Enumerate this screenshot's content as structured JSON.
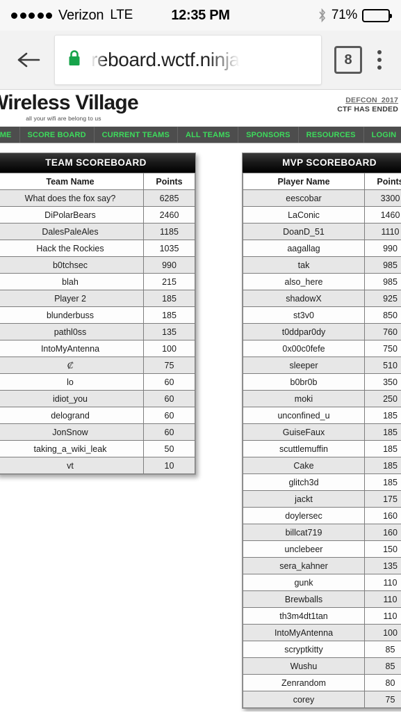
{
  "status_bar": {
    "signal_dots": 5,
    "carrier": "Verizon",
    "network": "LTE",
    "time": "12:35 PM",
    "bluetooth_icon": "bluetooth-icon",
    "battery_percent": "71%",
    "battery_level": 75
  },
  "browser": {
    "back_icon": "back-arrow-icon",
    "lock_icon": "lock-icon",
    "url": "reboard.wctf.ninja",
    "tab_count": "8",
    "menu_icon": "overflow-menu-icon"
  },
  "site": {
    "brand_title": "Wireless Village",
    "tagline": "all your wifi are belong to us",
    "defcon_link": "DEFCON_2017",
    "defcon_status": "CTF HAS ENDED",
    "nav": [
      {
        "label": "OME"
      },
      {
        "label": "SCORE BOARD"
      },
      {
        "label": "CURRENT TEAMS"
      },
      {
        "label": "ALL TEAMS"
      },
      {
        "label": "SPONSORS"
      },
      {
        "label": "RESOURCES"
      },
      {
        "label": "LOGIN"
      }
    ],
    "nav_text_color": "#3ddb5c",
    "nav_bg_color": "#4d4d4d"
  },
  "team_scoreboard": {
    "title": "TEAM SCOREBOARD",
    "columns": [
      "Team Name",
      "Points"
    ],
    "rows": [
      {
        "name": "What does the fox say?",
        "points": "6285"
      },
      {
        "name": "DiPolarBears",
        "points": "2460"
      },
      {
        "name": "DalesPaleAles",
        "points": "1185"
      },
      {
        "name": "Hack the Rockies",
        "points": "1035"
      },
      {
        "name": "b0tchsec",
        "points": "990"
      },
      {
        "name": "blah",
        "points": "215"
      },
      {
        "name": "Player 2",
        "points": "185"
      },
      {
        "name": "blunderbuss",
        "points": "185"
      },
      {
        "name": "pathl0ss",
        "points": "135"
      },
      {
        "name": "IntoMyAntenna",
        "points": "100"
      },
      {
        "name": "₡",
        "points": "75"
      },
      {
        "name": "lo",
        "points": "60"
      },
      {
        "name": "idiot_you",
        "points": "60"
      },
      {
        "name": "delogrand",
        "points": "60"
      },
      {
        "name": "JonSnow",
        "points": "60"
      },
      {
        "name": "taking_a_wiki_leak",
        "points": "50"
      },
      {
        "name": "vt",
        "points": "10"
      }
    ]
  },
  "mvp_scoreboard": {
    "title": "MVP SCOREBOARD",
    "columns": [
      "Player Name",
      "Points"
    ],
    "rows": [
      {
        "name": "eescobar",
        "points": "3300"
      },
      {
        "name": "LaConic",
        "points": "1460"
      },
      {
        "name": "DoanD_51",
        "points": "1110"
      },
      {
        "name": "aagallag",
        "points": "990"
      },
      {
        "name": "tak",
        "points": "985"
      },
      {
        "name": "also_here",
        "points": "985"
      },
      {
        "name": "shadowX",
        "points": "925"
      },
      {
        "name": "st3v0",
        "points": "850"
      },
      {
        "name": "t0ddpar0dy",
        "points": "760"
      },
      {
        "name": "0x00c0fefe",
        "points": "750"
      },
      {
        "name": "sleeper",
        "points": "510"
      },
      {
        "name": "b0br0b",
        "points": "350"
      },
      {
        "name": "moki",
        "points": "250"
      },
      {
        "name": "unconfined_u",
        "points": "185"
      },
      {
        "name": "GuiseFaux",
        "points": "185"
      },
      {
        "name": "scuttlemuffin",
        "points": "185"
      },
      {
        "name": "Cake",
        "points": "185"
      },
      {
        "name": "glitch3d",
        "points": "185"
      },
      {
        "name": "jackt",
        "points": "175"
      },
      {
        "name": "doylersec",
        "points": "160"
      },
      {
        "name": "billcat719",
        "points": "160"
      },
      {
        "name": "unclebeer",
        "points": "150"
      },
      {
        "name": "sera_kahner",
        "points": "135"
      },
      {
        "name": "gunk",
        "points": "110"
      },
      {
        "name": "Brewballs",
        "points": "110"
      },
      {
        "name": "th3m4dt1tan",
        "points": "110"
      },
      {
        "name": "IntoMyAntenna",
        "points": "100"
      },
      {
        "name": "scryptkitty",
        "points": "85"
      },
      {
        "name": "Wushu",
        "points": "85"
      },
      {
        "name": "Zenrandom",
        "points": "80"
      },
      {
        "name": "corey",
        "points": "75"
      }
    ]
  }
}
